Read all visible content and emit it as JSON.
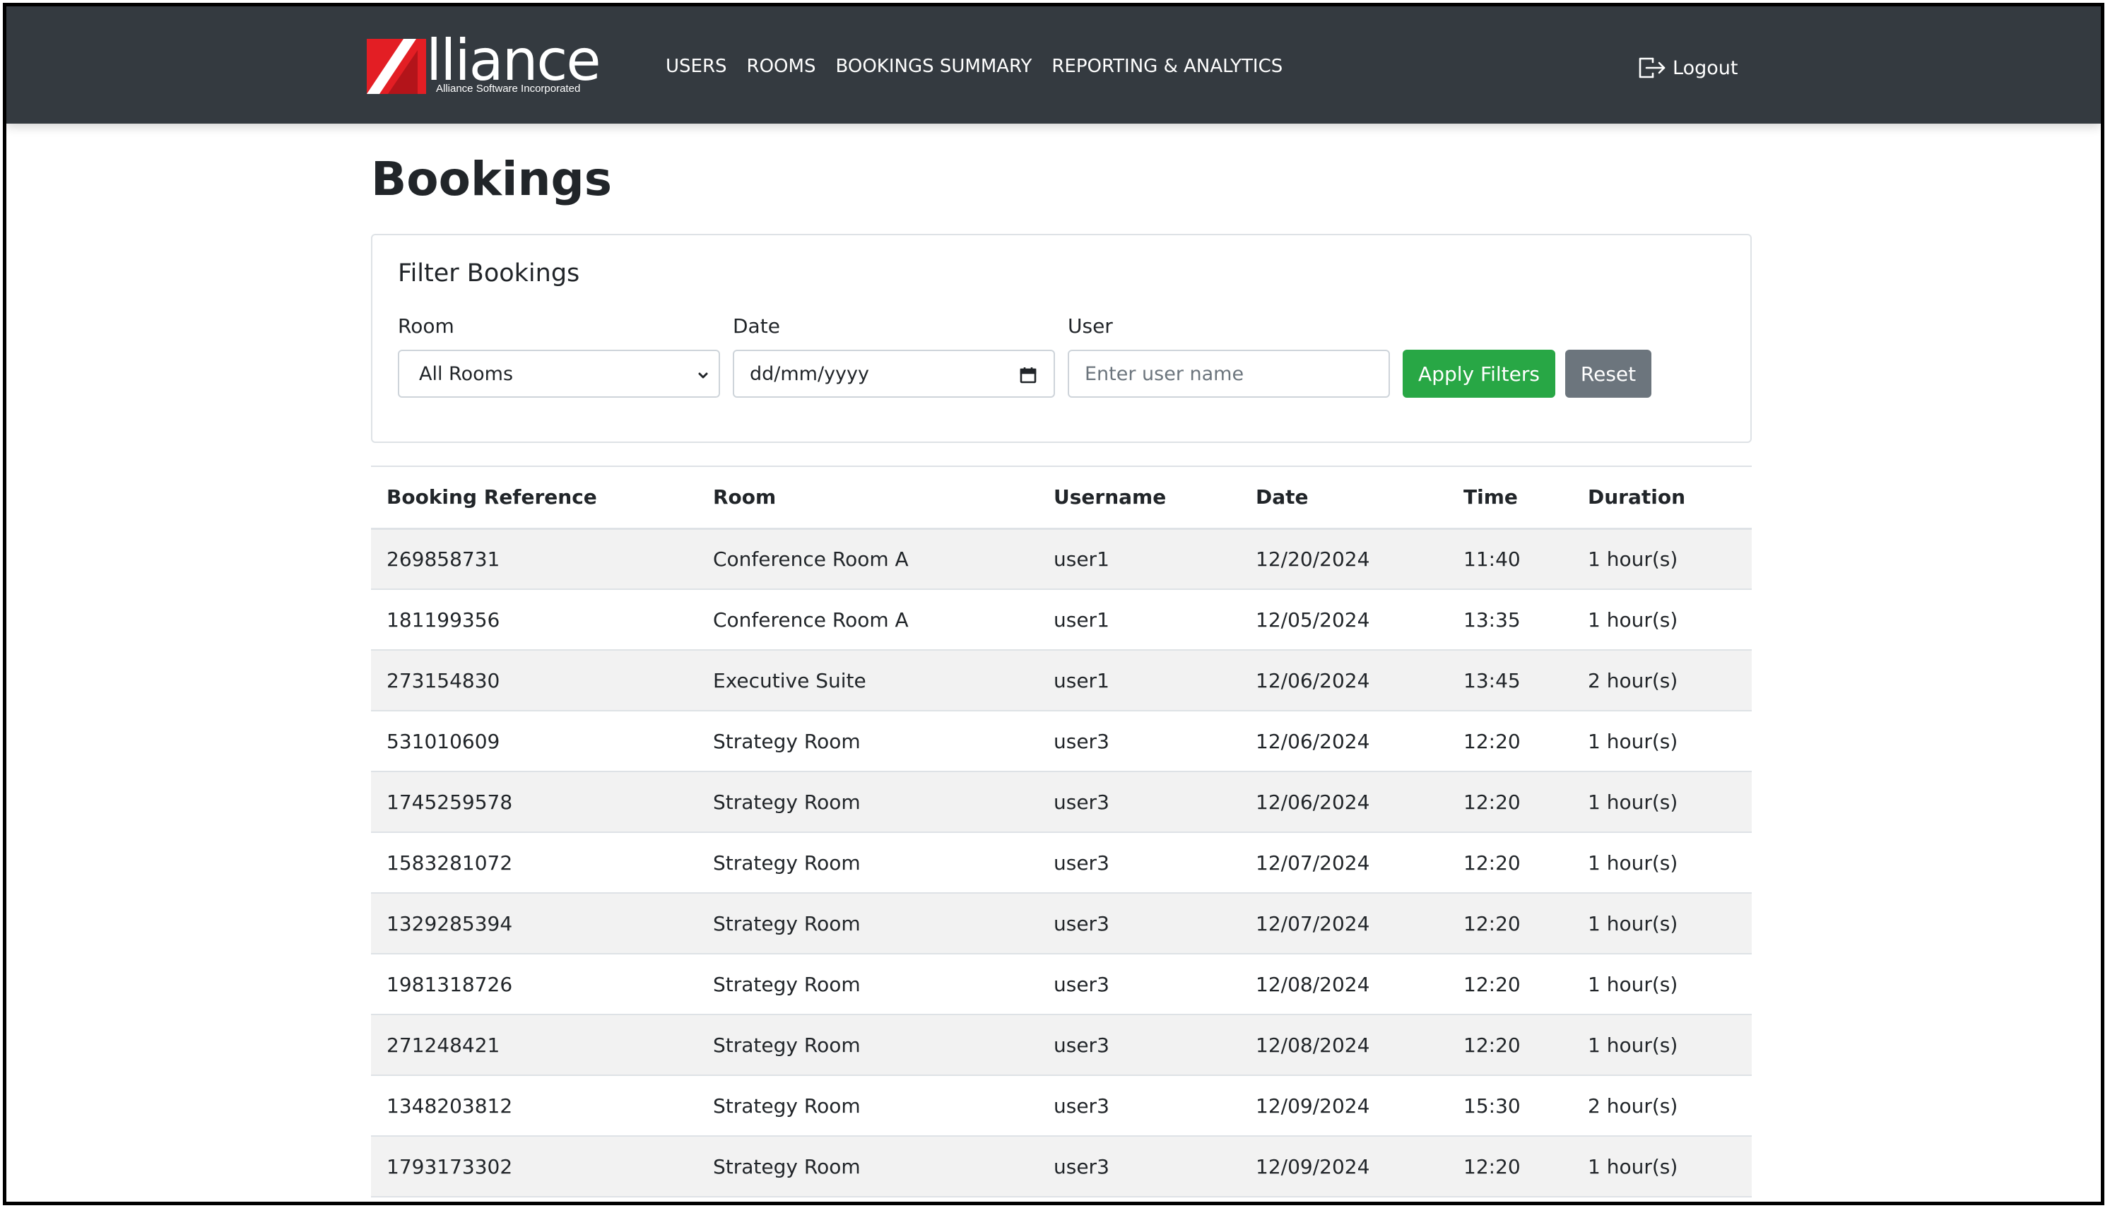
{
  "brand": {
    "name": "lliance",
    "tagline": "Alliance Software Incorporated"
  },
  "nav": {
    "links": [
      "USERS",
      "ROOMS",
      "BOOKINGS SUMMARY",
      "REPORTING & ANALYTICS"
    ],
    "logout_label": "Logout"
  },
  "page": {
    "title": "Bookings"
  },
  "filters": {
    "title": "Filter Bookings",
    "room_label": "Room",
    "room_value": "All Rooms",
    "date_label": "Date",
    "date_placeholder": "dd/mm/yyyy",
    "user_label": "User",
    "user_placeholder": "Enter user name",
    "apply_label": "Apply Filters",
    "reset_label": "Reset"
  },
  "table": {
    "headers": [
      "Booking Reference",
      "Room",
      "Username",
      "Date",
      "Time",
      "Duration"
    ],
    "rows": [
      [
        "269858731",
        "Conference Room A",
        "user1",
        "12/20/2024",
        "11:40",
        "1 hour(s)"
      ],
      [
        "181199356",
        "Conference Room A",
        "user1",
        "12/05/2024",
        "13:35",
        "1 hour(s)"
      ],
      [
        "273154830",
        "Executive Suite",
        "user1",
        "12/06/2024",
        "13:45",
        "2 hour(s)"
      ],
      [
        "531010609",
        "Strategy Room",
        "user3",
        "12/06/2024",
        "12:20",
        "1 hour(s)"
      ],
      [
        "1745259578",
        "Strategy Room",
        "user3",
        "12/06/2024",
        "12:20",
        "1 hour(s)"
      ],
      [
        "1583281072",
        "Strategy Room",
        "user3",
        "12/07/2024",
        "12:20",
        "1 hour(s)"
      ],
      [
        "1329285394",
        "Strategy Room",
        "user3",
        "12/07/2024",
        "12:20",
        "1 hour(s)"
      ],
      [
        "1981318726",
        "Strategy Room",
        "user3",
        "12/08/2024",
        "12:20",
        "1 hour(s)"
      ],
      [
        "271248421",
        "Strategy Room",
        "user3",
        "12/08/2024",
        "12:20",
        "1 hour(s)"
      ],
      [
        "1348203812",
        "Strategy Room",
        "user3",
        "12/09/2024",
        "15:30",
        "2 hour(s)"
      ],
      [
        "1793173302",
        "Strategy Room",
        "user3",
        "12/09/2024",
        "12:20",
        "1 hour(s)"
      ]
    ]
  },
  "colors": {
    "navbar": "#343a40",
    "brand_red": "#e31e24",
    "apply": "#28a745",
    "reset": "#6c757d"
  }
}
